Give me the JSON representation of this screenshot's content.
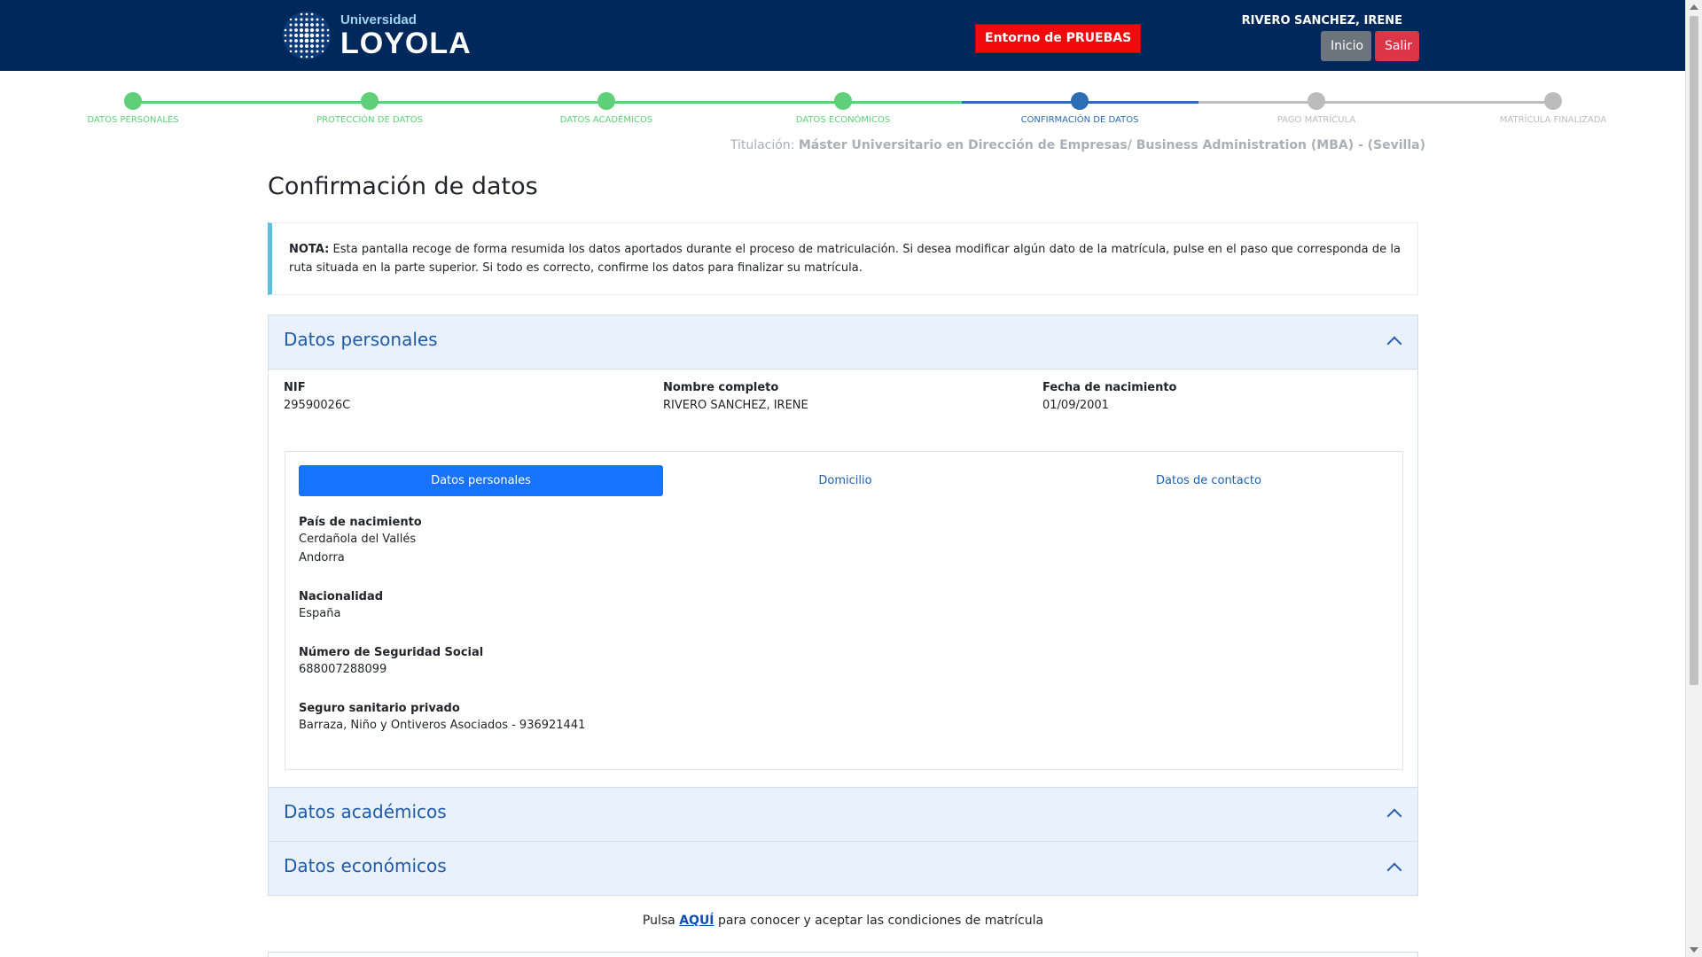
{
  "header": {
    "logo_small": "Universidad",
    "logo_big": "LOYOLA",
    "env_badge": "Entorno de PRUEBAS",
    "user_name": "RIVERO SANCHEZ, IRENE",
    "inicio_label": "Inicio",
    "salir_label": "Salir",
    "background_color": "#00285a"
  },
  "stepper": {
    "steps": [
      {
        "label": "DATOS PERSONALES",
        "status": "done"
      },
      {
        "label": "PROTECCIÓN DE DATOS",
        "status": "done"
      },
      {
        "label": "DATOS ACADÉMICOS",
        "status": "done"
      },
      {
        "label": "DATOS ECONÓMICOS",
        "status": "done"
      },
      {
        "label": "CONFIRMACIÓN DE DATOS",
        "status": "current"
      },
      {
        "label": "PAGO MATRÍCULA",
        "status": "pending"
      },
      {
        "label": "MATRÍCULA FINALIZADA",
        "status": "pending"
      }
    ],
    "colors": {
      "done": "#5fcf78",
      "current": "#2c6db5",
      "pending": "#bcbcbc"
    }
  },
  "titulacion": {
    "prefix": "Titulación:",
    "value": "Máster Universitario en Dirección de Empresas/ Business Administration (MBA) - (Sevilla)"
  },
  "page_title": "Confirmación de datos",
  "note": {
    "bold": "NOTA:",
    "text": " Esta pantalla recoge de forma resumida los datos aportados durante el proceso de matriculación. Si desea modificar algún dato de la matrícula, pulse en el paso que corresponda de la ruta situada en la parte superior. Si todo es correcto, confirme los datos para finalizar su matrícula."
  },
  "sections": {
    "personales": {
      "title": "Datos personales",
      "nif_label": "NIF",
      "nif_value": "29590026C",
      "nombre_label": "Nombre completo",
      "nombre_value": "RIVERO SANCHEZ, IRENE",
      "fecha_label": "Fecha de nacimiento",
      "fecha_value": "01/09/2001",
      "tabs": [
        "Datos personales",
        "Domicilio",
        "Datos de contacto"
      ],
      "pais_label": "País de nacimiento",
      "pais_line1": "Cerdañola del Vallés",
      "pais_line2": "Andorra",
      "nacionalidad_label": "Nacionalidad",
      "nacionalidad_value": "España",
      "nss_label": "Número de Seguridad Social",
      "nss_value": "688007288099",
      "seguro_label": "Seguro sanitario privado",
      "seguro_value": "Barraza, Niño y Ontiveros Asociados - 936921441"
    },
    "academicos": {
      "title": "Datos académicos"
    },
    "economicos": {
      "title": "Datos económicos"
    }
  },
  "footer": {
    "before": "Pulsa ",
    "link": "AQUÍ",
    "after": " para conocer y aceptar las condiciones de matrícula"
  }
}
